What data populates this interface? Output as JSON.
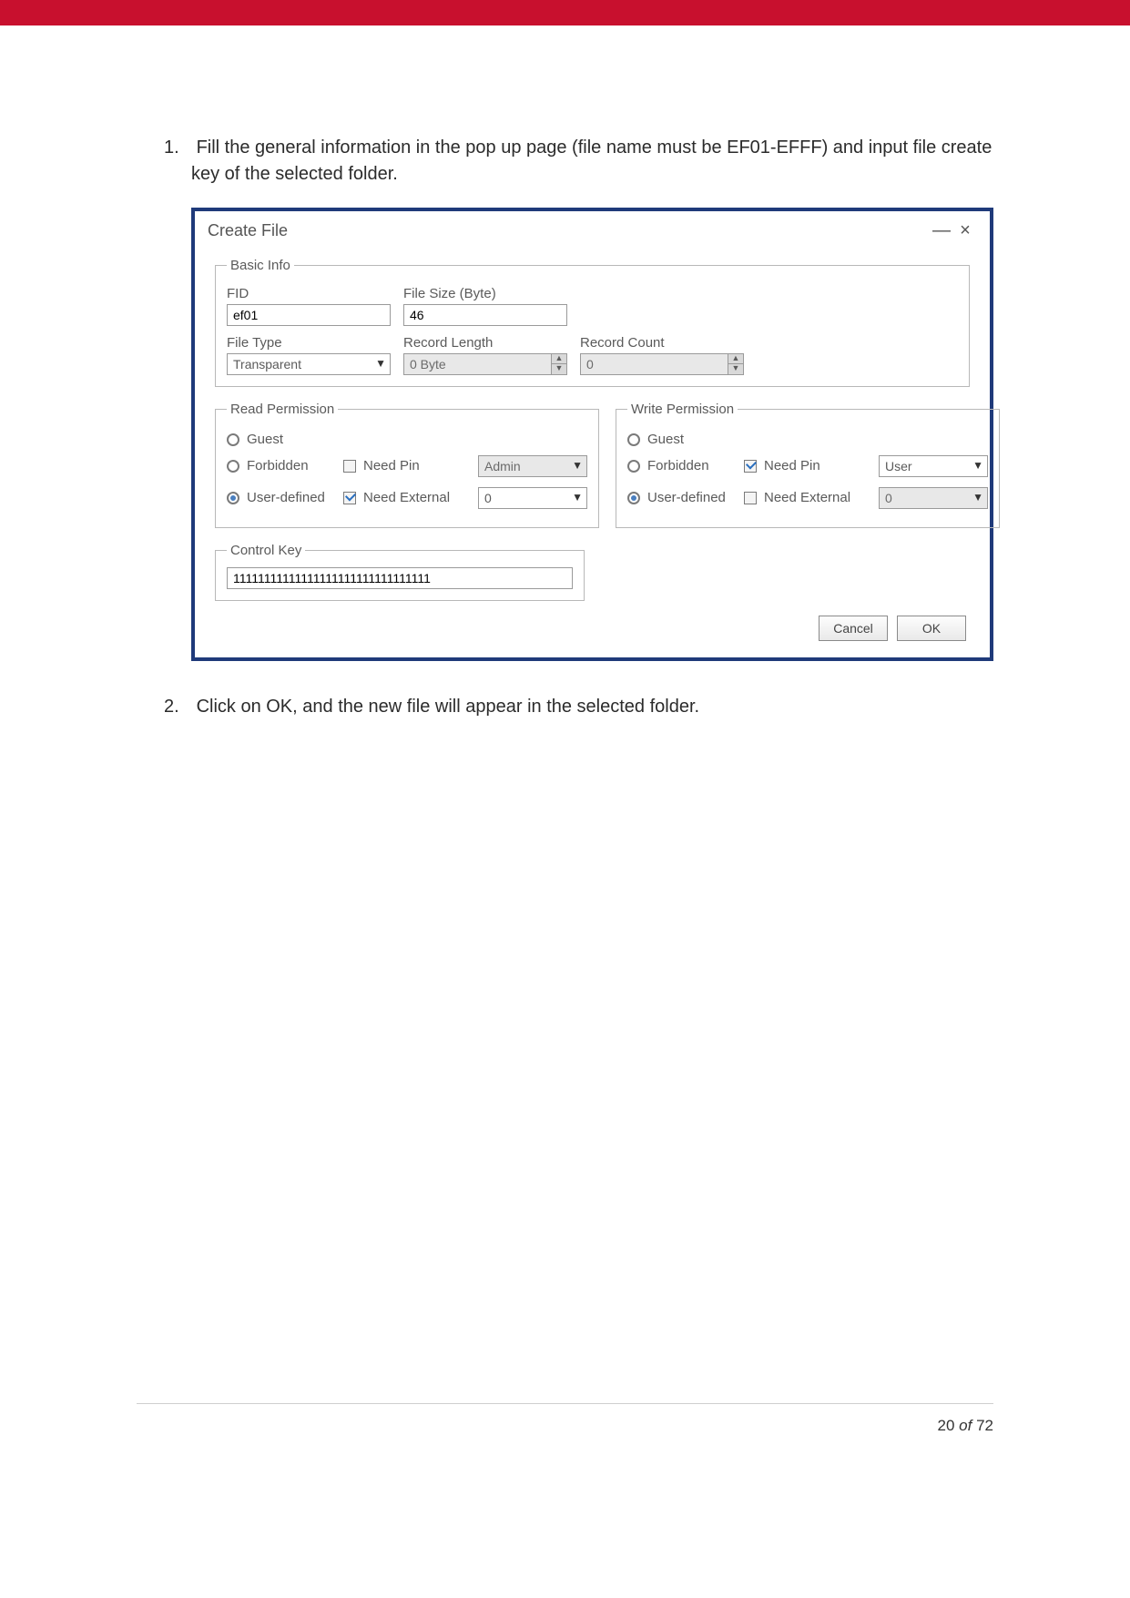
{
  "steps": {
    "s1_num": "1.",
    "s1_text": "Fill the general information in the pop up page (file name must be EF01-EFFF) and input file create key of the selected folder.",
    "s2_num": "2.",
    "s2_text": "Click on OK, and the new file will appear in the selected folder."
  },
  "dialog": {
    "title": "Create File",
    "minimize": "—",
    "close": "×",
    "basic": {
      "legend": "Basic Info",
      "fid_label": "FID",
      "fid_value": "ef01",
      "size_label": "File Size (Byte)",
      "size_value": "46",
      "type_label": "File Type",
      "type_value": "Transparent",
      "reclen_label": "Record Length",
      "reclen_value": "0 Byte",
      "reccount_label": "Record Count",
      "reccount_value": "0"
    },
    "read": {
      "legend": "Read Permission",
      "guest": "Guest",
      "forbidden": "Forbidden",
      "needpin": "Need Pin",
      "pin_sel": "Admin",
      "userdef": "User-defined",
      "needext": "Need External",
      "ext_sel": "0"
    },
    "write": {
      "legend": "Write Permission",
      "guest": "Guest",
      "forbidden": "Forbidden",
      "needpin": "Need Pin",
      "pin_sel": "User",
      "userdef": "User-defined",
      "needext": "Need External",
      "ext_sel": "0"
    },
    "ctrl": {
      "legend": "Control Key",
      "value": "11111111111111111111111111111111"
    },
    "buttons": {
      "cancel": "Cancel",
      "ok": "OK"
    }
  },
  "footer": {
    "page_a": "20",
    "of": " of ",
    "page_b": "72"
  }
}
